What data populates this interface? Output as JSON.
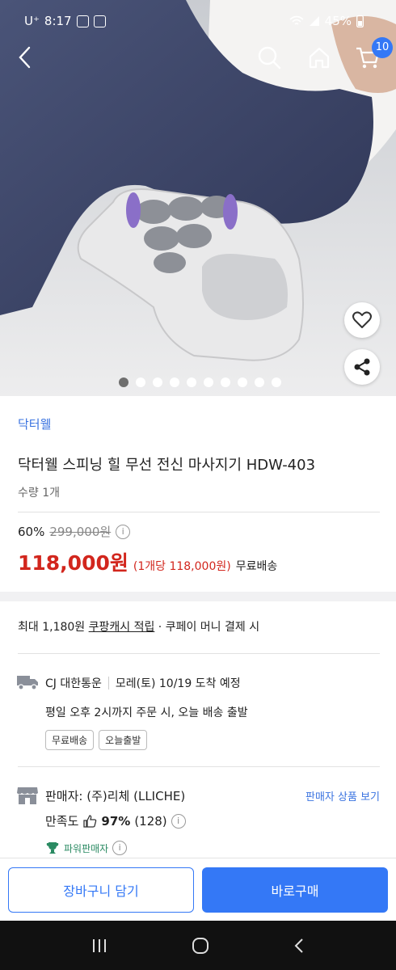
{
  "status": {
    "carrier": "U⁺",
    "time": "8:17",
    "battery": "45%"
  },
  "header": {
    "cart_count": "10",
    "icons": [
      "back-arrow-icon",
      "search-icon",
      "home-icon",
      "cart-icon"
    ]
  },
  "gallery": {
    "image_count": 10,
    "active_index": 0
  },
  "product": {
    "brand": "닥터웰",
    "title": "닥터웰 스피닝 힐 무선 전신 마사지기 HDW-403",
    "quantity": "수량  1개",
    "discount": "60%",
    "original_price": "299,000원",
    "price": "118,000원",
    "unit_price": "(1개당 118,000원)",
    "shipping_fee": "무료배송"
  },
  "coupon": {
    "prefix": "최대 1,180원 ",
    "link": "쿠팡캐시 적립",
    "suffix": " · 쿠페이 머니 결제 시"
  },
  "shipping": {
    "carrier": "CJ 대한통운",
    "eta": "모레(토) 10/19 도착 예정",
    "note": "평일 오후 2시까지 주문 시, 오늘 배송 출발",
    "tags": [
      "무료배송",
      "오늘출발"
    ]
  },
  "seller": {
    "label": "판매자: ",
    "name": "(주)리체 (LLICHE)",
    "link": "판매자 상품 보기",
    "satisfaction_label": "만족도",
    "satisfaction_value": "97%",
    "review_count": "(128)",
    "badge": "파워판매자"
  },
  "actions": {
    "add_to_cart": "장바구니 담기",
    "buy_now": "바로구매"
  },
  "colors": {
    "accent": "#3478f6",
    "price": "#d2261d",
    "brand_link": "#3a73e0"
  }
}
